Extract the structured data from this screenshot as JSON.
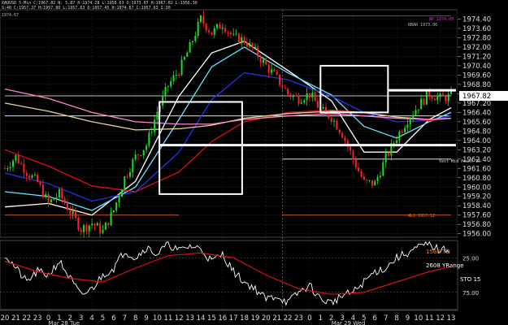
{
  "header": {
    "line1": "XAUUSD 5-Min  C:1967.82  N:  5.87  H:1974.28  L:1958.63  O:1973.07  H:1967.82  L:1956.30",
    "line2": "S:40  C:1957.37  H:1957.80  L:1957.63  O:1957.45  H:1974.67  C:1957.63  S:30",
    "line3": "1974.67"
  },
  "labels": {
    "vwap_top": "WP  1974.09",
    "rbar": "RBAR 1973.06",
    "pivot": "Yest Mid Point  15",
    "lower": "WL2  1957.12",
    "td": "1565 TD",
    "yrange": "2608 YRange",
    "sto": "STO  15",
    "osc_top": "25.00",
    "osc_bottom": "75.00"
  },
  "colors": {
    "background": "#000000",
    "candle_up": "#22dd22",
    "candle_down": "#ff2222",
    "ma_white": "#ffffff",
    "ma_cyan": "#66e8ff",
    "ma_blue": "#2233ee",
    "ma_red": "#dd1111",
    "ma_tan": "#e8d29a",
    "ma_pink": "#ff88cc",
    "resistance": "#cc33cc",
    "support_orange": "#ff7722",
    "osc_line": "#ffffff",
    "signal_line": "#dd1111",
    "grid": "#555555"
  },
  "chart_data": {
    "type": "candlestick",
    "title": "",
    "instrument": "XAUUSD 5-Min",
    "ylim": [
      1955.7,
      1975.2
    ],
    "yticks": [
      "1974.40",
      "1973.60",
      "1972.80",
      "1972.00",
      "1971.20",
      "1970.40",
      "1969.60",
      "1968.80",
      "1968.00",
      "1967.20",
      "1966.40",
      "1965.60",
      "1964.80",
      "1964.00",
      "1963.20",
      "1962.40",
      "1961.60",
      "1960.80",
      "1960.00",
      "1959.20",
      "1958.40",
      "1957.60",
      "1956.80",
      "1956.00"
    ],
    "last_price": "1967.82",
    "xticks": [
      "20",
      "21",
      "22",
      "23",
      "0",
      "1",
      "2",
      "3",
      "4",
      "5",
      "6",
      "7",
      "8",
      "9",
      "10",
      "11",
      "12",
      "13",
      "14",
      "15",
      "16",
      "17",
      "18",
      "19",
      "20",
      "21",
      "22",
      "23",
      "0",
      "1",
      "2",
      "3",
      "4",
      "5",
      "6",
      "7",
      "8",
      "9",
      "10",
      "11",
      "12",
      "13"
    ],
    "date_labels": [
      "Mar 28 Tue",
      "Mar 29 Wed"
    ],
    "price_path": [
      [
        0,
        1961.6
      ],
      [
        1,
        1962.6
      ],
      [
        2,
        1961.3
      ],
      [
        3,
        1960.4
      ],
      [
        4,
        1958.6
      ],
      [
        5,
        1959.4
      ],
      [
        6,
        1957.9
      ],
      [
        7,
        1956.4
      ],
      [
        8,
        1956.9
      ],
      [
        9,
        1956.2
      ],
      [
        10,
        1958.0
      ],
      [
        11,
        1960.8
      ],
      [
        12,
        1962.6
      ],
      [
        13,
        1963.6
      ],
      [
        14,
        1966.5
      ],
      [
        15,
        1968.7
      ],
      [
        16,
        1970.0
      ],
      [
        17,
        1972.0
      ],
      [
        18,
        1974.4
      ],
      [
        19,
        1973.2
      ],
      [
        20,
        1974.0
      ],
      [
        21,
        1972.8
      ],
      [
        22,
        1972.6
      ],
      [
        23,
        1971.6
      ],
      [
        24,
        1970.4
      ],
      [
        25,
        1969.3
      ],
      [
        26,
        1968.0
      ],
      [
        27,
        1967.6
      ],
      [
        28,
        1968.0
      ],
      [
        29,
        1966.6
      ],
      [
        30,
        1966.0
      ],
      [
        31,
        1964.6
      ],
      [
        32,
        1962.4
      ],
      [
        33,
        1960.4
      ],
      [
        34,
        1960.3
      ],
      [
        35,
        1962.5
      ],
      [
        36,
        1964.3
      ],
      [
        37,
        1965.8
      ],
      [
        38,
        1967.0
      ],
      [
        39,
        1968.0
      ],
      [
        40,
        1967.6
      ],
      [
        41,
        1967.8
      ]
    ],
    "series": [
      {
        "name": "",
        "color_key": "ma_white",
        "values": [
          [
            0,
            1958.3
          ],
          [
            4,
            1958.6
          ],
          [
            8,
            1957.6
          ],
          [
            12,
            1960.5
          ],
          [
            16,
            1967.8
          ],
          [
            19,
            1971.5
          ],
          [
            22,
            1972.5
          ],
          [
            26,
            1970.0
          ],
          [
            30,
            1967.4
          ],
          [
            33,
            1963.0
          ],
          [
            36,
            1963.0
          ],
          [
            39,
            1965.8
          ],
          [
            41,
            1966.8
          ]
        ]
      },
      {
        "name": "",
        "color_key": "ma_cyan",
        "values": [
          [
            0,
            1959.6
          ],
          [
            4,
            1959.2
          ],
          [
            8,
            1958.0
          ],
          [
            12,
            1960.0
          ],
          [
            16,
            1965.8
          ],
          [
            19,
            1970.3
          ],
          [
            22,
            1972.0
          ],
          [
            26,
            1969.8
          ],
          [
            30,
            1967.9
          ],
          [
            33,
            1965.2
          ],
          [
            36,
            1964.2
          ],
          [
            39,
            1965.6
          ],
          [
            41,
            1966.4
          ]
        ]
      },
      {
        "name": "",
        "color_key": "ma_blue",
        "values": [
          [
            0,
            1961.2
          ],
          [
            4,
            1960.3
          ],
          [
            8,
            1958.8
          ],
          [
            12,
            1959.6
          ],
          [
            16,
            1963.0
          ],
          [
            19,
            1967.5
          ],
          [
            22,
            1969.8
          ],
          [
            26,
            1969.2
          ],
          [
            30,
            1967.8
          ],
          [
            33,
            1966.4
          ],
          [
            36,
            1965.6
          ],
          [
            39,
            1965.7
          ],
          [
            41,
            1966.1
          ]
        ]
      },
      {
        "name": "",
        "color_key": "ma_red",
        "values": [
          [
            0,
            1963.2
          ],
          [
            4,
            1961.8
          ],
          [
            8,
            1960.1
          ],
          [
            12,
            1959.6
          ],
          [
            16,
            1961.3
          ],
          [
            19,
            1963.9
          ],
          [
            22,
            1965.6
          ],
          [
            26,
            1966.4
          ],
          [
            30,
            1966.6
          ],
          [
            33,
            1966.4
          ],
          [
            36,
            1966.0
          ],
          [
            39,
            1965.7
          ],
          [
            41,
            1965.9
          ]
        ]
      },
      {
        "name": "",
        "color_key": "ma_tan",
        "values": [
          [
            0,
            1967.2
          ],
          [
            4,
            1966.5
          ],
          [
            8,
            1965.6
          ],
          [
            12,
            1964.9
          ],
          [
            16,
            1965.0
          ],
          [
            19,
            1965.3
          ],
          [
            22,
            1965.9
          ],
          [
            26,
            1966.3
          ],
          [
            30,
            1966.5
          ],
          [
            33,
            1966.4
          ],
          [
            36,
            1966.0
          ],
          [
            39,
            1965.8
          ],
          [
            41,
            1965.9
          ]
        ]
      },
      {
        "name": "",
        "color_key": "ma_pink",
        "values": [
          [
            0,
            1968.4
          ],
          [
            4,
            1967.6
          ],
          [
            8,
            1966.4
          ],
          [
            12,
            1965.6
          ],
          [
            16,
            1965.4
          ],
          [
            19,
            1965.4
          ],
          [
            22,
            1965.8
          ],
          [
            26,
            1966.1
          ],
          [
            30,
            1966.3
          ],
          [
            33,
            1966.1
          ],
          [
            36,
            1965.9
          ],
          [
            39,
            1965.8
          ],
          [
            41,
            1965.9
          ]
        ]
      }
    ],
    "horizontal_levels": [
      {
        "y": 1974.67,
        "color_key": "resistance",
        "x_from": 25.5,
        "x_to": 41
      },
      {
        "y": 1967.82,
        "color_key": "ma_white",
        "x_from": 0,
        "x_to": 41
      },
      {
        "y": 1966.1,
        "color_key": "ma_white",
        "x_from": 0,
        "x_to": 41
      },
      {
        "y": 1962.4,
        "color_key": "ma_white",
        "x_from": 25.5,
        "x_to": 41
      },
      {
        "y": 1957.6,
        "color_key": "support_orange",
        "x_from": 25.5,
        "x_to": 41
      },
      {
        "y": 1957.6,
        "color_key": "support_orange",
        "x_from": 0,
        "x_to": 16
      }
    ],
    "annotation_boxes": [
      {
        "x1": 14.2,
        "x2": 21.8,
        "y1": 1959.4,
        "y2": 1967.3
      },
      {
        "x1": 29.0,
        "x2": 35.2,
        "y1": 1966.4,
        "y2": 1970.4
      }
    ],
    "annotation_lines": [
      {
        "x1": 35.2,
        "x2": 44.5,
        "y": 1968.3
      },
      {
        "x1": 14.2,
        "x2": 43.3,
        "y": 1963.6
      }
    ],
    "oscillator": {
      "title": "STO",
      "ylim": [
        0,
        100
      ],
      "yticks": [
        "25.00",
        "75.00"
      ],
      "k_line": [
        [
          0,
          80
        ],
        [
          1,
          60
        ],
        [
          2,
          40
        ],
        [
          3,
          55
        ],
        [
          4,
          50
        ],
        [
          5,
          70
        ],
        [
          6,
          45
        ],
        [
          7,
          20
        ],
        [
          8,
          30
        ],
        [
          9,
          50
        ],
        [
          10,
          60
        ],
        [
          11,
          85
        ],
        [
          12,
          75
        ],
        [
          13,
          90
        ],
        [
          14,
          80
        ],
        [
          15,
          95
        ],
        [
          16,
          85
        ],
        [
          17,
          92
        ],
        [
          18,
          88
        ],
        [
          19,
          70
        ],
        [
          20,
          80
        ],
        [
          21,
          55
        ],
        [
          22,
          40
        ],
        [
          23,
          30
        ],
        [
          24,
          15
        ],
        [
          25,
          20
        ],
        [
          26,
          10
        ],
        [
          27,
          25
        ],
        [
          28,
          35
        ],
        [
          29,
          15
        ],
        [
          30,
          10
        ],
        [
          31,
          20
        ],
        [
          32,
          25
        ],
        [
          33,
          40
        ],
        [
          34,
          55
        ],
        [
          35,
          60
        ],
        [
          36,
          75
        ],
        [
          37,
          82
        ],
        [
          38,
          90
        ],
        [
          39,
          95
        ],
        [
          40,
          85
        ],
        [
          41,
          88
        ]
      ],
      "d_line": [
        [
          0,
          70
        ],
        [
          3,
          55
        ],
        [
          6,
          45
        ],
        [
          9,
          40
        ],
        [
          12,
          60
        ],
        [
          15,
          78
        ],
        [
          18,
          82
        ],
        [
          21,
          75
        ],
        [
          24,
          50
        ],
        [
          27,
          30
        ],
        [
          30,
          22
        ],
        [
          33,
          25
        ],
        [
          36,
          40
        ],
        [
          39,
          55
        ],
        [
          41,
          62
        ]
      ]
    }
  }
}
